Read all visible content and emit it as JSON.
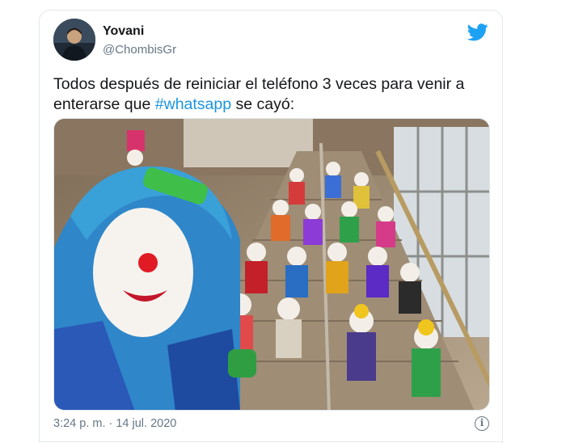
{
  "tweet": {
    "author_name": "Yovani",
    "author_handle": "@ChombisGr",
    "text_before": "Todos después de reiniciar el teléfono 3 veces para venir a enterarse que ",
    "hashtag": "#whatsapp",
    "text_after": " se cayó:",
    "timestamp": "3:24 p. m. · 14 jul. 2020",
    "info_glyph": "i"
  },
  "icons": {
    "brand": "twitter-bird-icon",
    "info": "info-icon"
  },
  "colors": {
    "link": "#1b95e0",
    "twitter_blue": "#1da1f2",
    "secondary_text": "#657786",
    "border": "#e1e8ed"
  }
}
